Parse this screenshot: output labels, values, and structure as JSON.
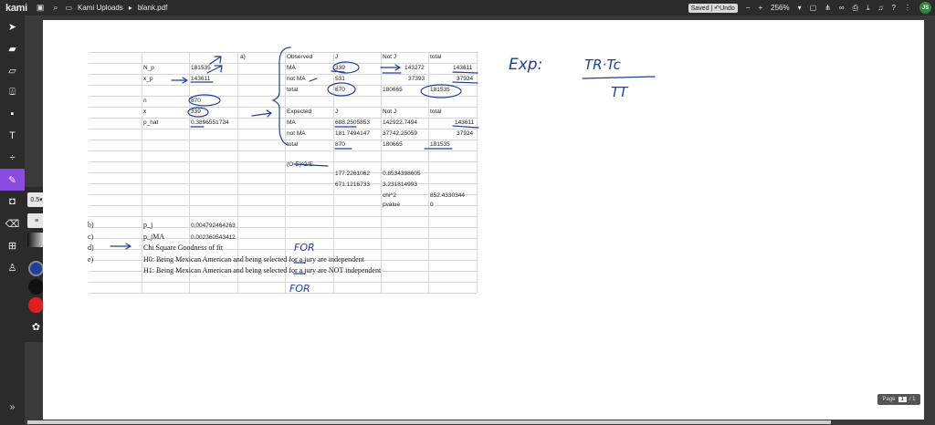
{
  "app": {
    "logo": "kami",
    "breadcrumb_folder": "Kami Uploads",
    "file_name": "blank.pdf",
    "saved_label": "Saved",
    "undo_label": "Undo",
    "zoom": "256%",
    "user_initials": "JS"
  },
  "flyout": {
    "stroke_size": "0.5",
    "colors": [
      "#1f3f9f",
      "#111111",
      "#e0201e"
    ]
  },
  "pager": {
    "label": "Page",
    "current": "1",
    "total": "/ 1"
  },
  "sheet": {
    "left_labels": {
      "a": "a)",
      "b": "b)",
      "c": "c)",
      "d": "d)",
      "e": "e)"
    },
    "N_p": "N_p",
    "N_p_val": "181535",
    "x_p": "x_p",
    "x_p_val": "143611",
    "n": "n",
    "n_val": "870",
    "x": "x",
    "x_val": "339",
    "p_hat": "p_hat",
    "p_hat_val": "0.3896551724",
    "p_j": "p_j",
    "p_j_val": "0.004792464263",
    "p_jMA": "p_jMA",
    "p_jMA_val": "0.002360543412",
    "d_text": "Chi Square Goodness of fit",
    "h0": "H0: Being Mexican American and being selected for a jury are independent",
    "h1": "H1: Being Mexican American and being selected for a jury are NOT independent",
    "observed": {
      "header": [
        "Observed",
        "J",
        "Not J",
        "total"
      ],
      "rows": [
        [
          "MA",
          "339",
          "143272",
          "143611"
        ],
        [
          "not MA",
          "531",
          "37393",
          "37924"
        ],
        [
          "total",
          "870",
          "180665",
          "181535"
        ]
      ]
    },
    "expected": {
      "header": [
        "Expected",
        "J",
        "Not J",
        "total"
      ],
      "rows": [
        [
          "MA",
          "688.2505853",
          "142922.7494",
          "143611"
        ],
        [
          "not MA",
          "181.7494147",
          "37742.25059",
          "37924"
        ],
        [
          "total",
          "870",
          "180665",
          "181535"
        ]
      ]
    },
    "chi": {
      "label": "(O-E)^2/E",
      "r1": [
        "177.2261062",
        "0.8534398605"
      ],
      "r2": [
        "671.1216733",
        "3.231814993"
      ],
      "chi_label": "chi^2",
      "chi_val": "852.4330344",
      "p_label": "pvalue",
      "p_val": "0"
    }
  },
  "handwriting": {
    "formula_left": "Exp:",
    "formula_num": "TR·Tc",
    "formula_den": "TT",
    "for1": "FOR",
    "for2": "FOR"
  }
}
